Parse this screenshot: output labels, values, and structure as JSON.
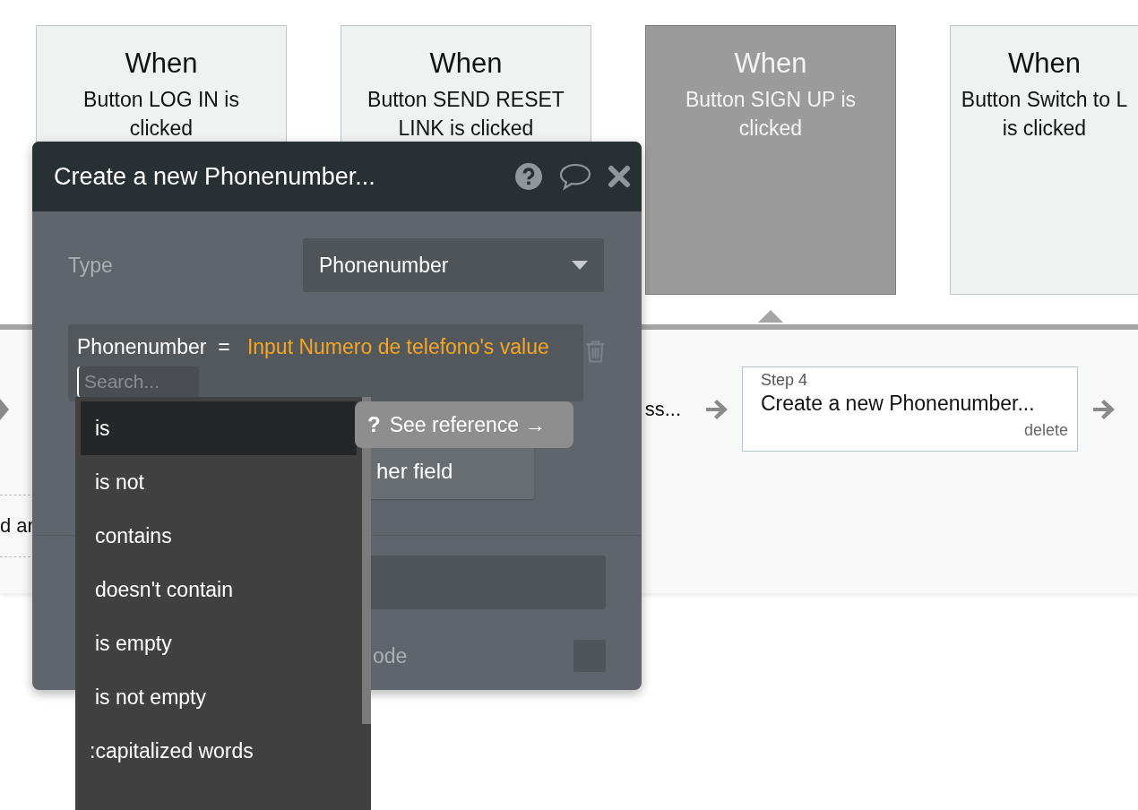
{
  "event_cards": [
    {
      "heading": "When",
      "description": [
        "Button LOG IN is",
        "clicked"
      ],
      "selected": false
    },
    {
      "heading": "When",
      "description": [
        "Button SEND RESET",
        "LINK is clicked"
      ],
      "selected": false
    },
    {
      "heading": "When",
      "description": [
        "Button SIGN UP is",
        "clicked"
      ],
      "selected": true
    },
    {
      "heading": "When",
      "description": [
        "Button Switch to L",
        "is clicked"
      ],
      "selected": false
    }
  ],
  "steps_band": {
    "left_partial_text": "d ar",
    "step_3_partial_title": "ss...",
    "step_4": {
      "label": "Step 4",
      "title": "Create a new Phonenumber...",
      "delete_link": "delete"
    }
  },
  "modal": {
    "title": "Create a new Phonenumber...",
    "type_label": "Type",
    "type_value": "Phonenumber",
    "field": {
      "name": "Phonenumber",
      "operator": "=",
      "value": "Input Numero de telefono's value"
    },
    "search": {
      "placeholder": "Search..."
    },
    "add_field_button": "her field",
    "rows": [
      {
        "kind": "input"
      },
      {
        "kind": "checkbox",
        "label": "ode",
        "checked": false
      }
    ]
  },
  "operator_menu": {
    "items": [
      {
        "kind": "operator",
        "label": "is",
        "selected": true
      },
      {
        "kind": "operator",
        "label": "is not",
        "selected": false
      },
      {
        "kind": "operator",
        "label": "contains",
        "selected": false
      },
      {
        "kind": "operator",
        "label": "doesn't contain",
        "selected": false
      },
      {
        "kind": "operator",
        "label": "is empty",
        "selected": false
      },
      {
        "kind": "operator",
        "label": "is not empty",
        "selected": false
      },
      {
        "kind": "transform",
        "label": ":capitalized words",
        "selected": false
      }
    ]
  },
  "tooltip": {
    "icon": "?",
    "label": "See reference →"
  }
}
